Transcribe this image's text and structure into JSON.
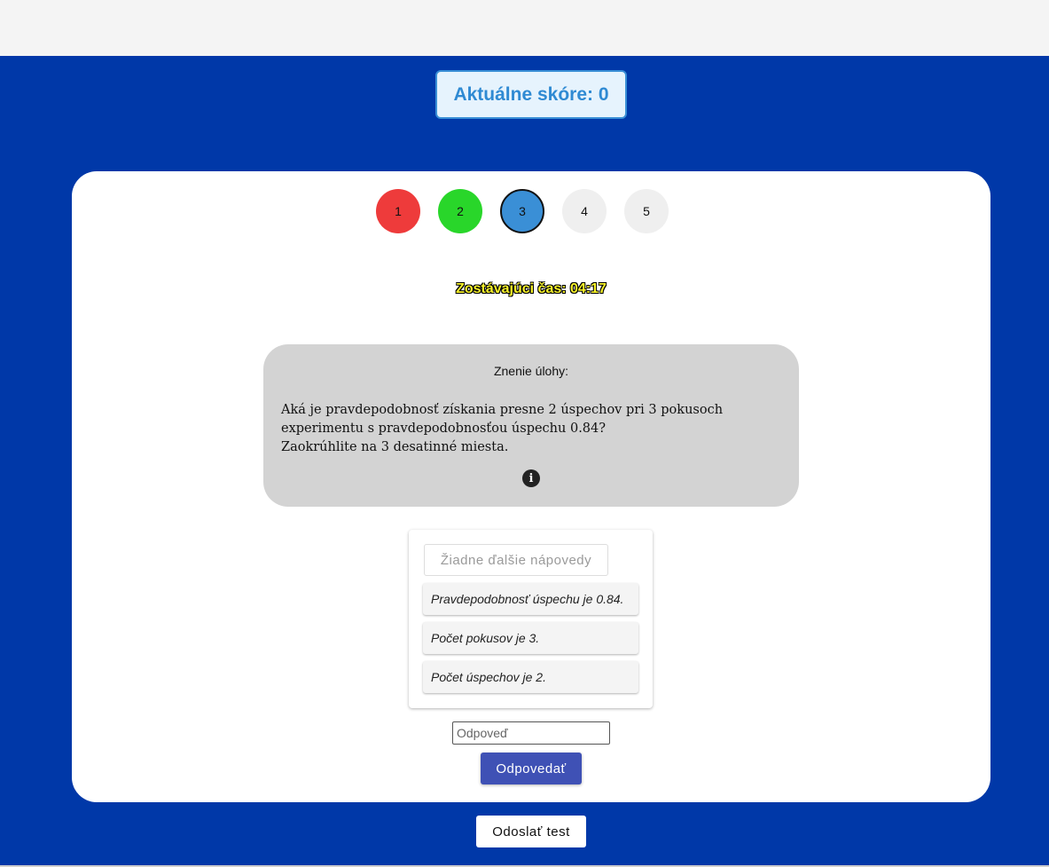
{
  "score": {
    "text": "Aktuálne skóre: 0"
  },
  "questions": [
    {
      "label": "1",
      "status": "wrong"
    },
    {
      "label": "2",
      "status": "correct"
    },
    {
      "label": "3",
      "status": "current"
    },
    {
      "label": "4",
      "status": "pending"
    },
    {
      "label": "5",
      "status": "pending"
    }
  ],
  "timer": {
    "text": "Zostávajúci čas: 04:17"
  },
  "task": {
    "title": "Znenie úlohy:",
    "lines": [
      "Aká je pravdepodobnosť získania presne 2 úspechov pri 3 pokusoch experimentu s pravdepodobnosťou úspechu 0.84?",
      "Zaokrúhlite na 3 desatinné miesta."
    ],
    "info_icon": "info-icon"
  },
  "hints": {
    "button_label": "Žiadne ďalšie nápovedy",
    "items": [
      "Pravdepodobnosť úspechu je 0.84.",
      "Počet pokusov je 3.",
      "Počet úspechov je 2."
    ]
  },
  "answer": {
    "placeholder": "Odpoveď",
    "value": "",
    "button_label": "Odpovedať"
  },
  "submit": {
    "label": "Odoslať test"
  },
  "colors": {
    "background": "#0038a8",
    "wrong": "#ee3b3b",
    "correct": "#29d62a",
    "current": "#3a8fd6",
    "pending": "#efefef",
    "primary_button": "#3f51b5",
    "timer": "#f7f22a"
  }
}
